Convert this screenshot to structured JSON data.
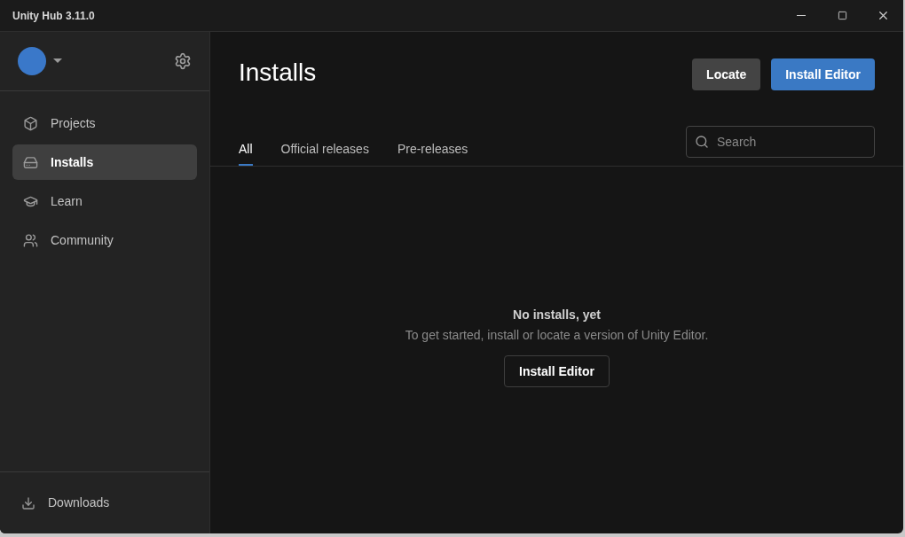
{
  "window": {
    "title": "Unity Hub 3.11.0"
  },
  "sidebar": {
    "items": [
      {
        "label": "Projects",
        "kind": "projects",
        "selected": false
      },
      {
        "label": "Installs",
        "kind": "installs",
        "selected": true
      },
      {
        "label": "Learn",
        "kind": "learn",
        "selected": false
      },
      {
        "label": "Community",
        "kind": "community",
        "selected": false
      }
    ],
    "footer": {
      "label": "Downloads"
    }
  },
  "page": {
    "title": "Installs",
    "buttons": [
      {
        "label": "Locate",
        "kind": "secondary"
      },
      {
        "label": "Install Editor",
        "kind": "primary"
      }
    ]
  },
  "tabs": [
    {
      "label": "All",
      "selected": true
    },
    {
      "label": "Official releases",
      "selected": false
    },
    {
      "label": "Pre-releases",
      "selected": false
    }
  ],
  "search": {
    "placeholder": "Search"
  },
  "empty_state": {
    "title": "No installs, yet",
    "message": "To get started, install or locate a version of Unity Editor.",
    "button": "Install Editor"
  }
}
